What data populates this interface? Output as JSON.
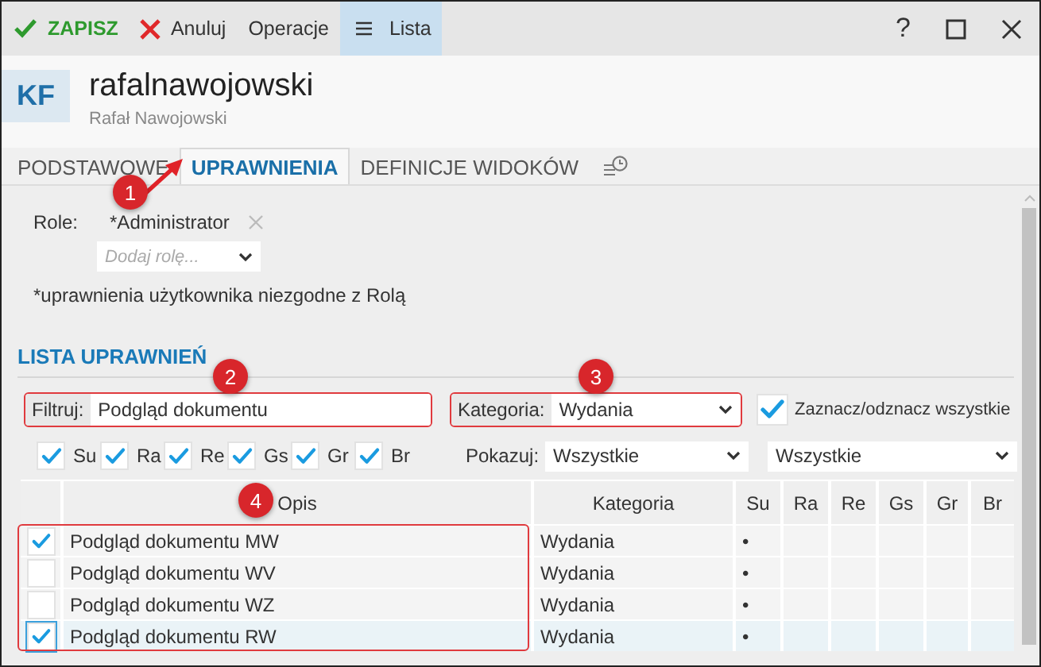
{
  "toolbar": {
    "buttons": [
      {
        "kind": "save",
        "label": "ZAPISZ",
        "selected": false
      },
      {
        "kind": "cancel",
        "label": "Anuluj",
        "selected": false
      },
      {
        "kind": "menu",
        "label": "Operacje",
        "selected": false
      },
      {
        "kind": "list",
        "label": "Lista",
        "selected": true
      }
    ],
    "window_buttons": [
      {
        "kind": "help",
        "label": "?"
      },
      {
        "kind": "maximize"
      },
      {
        "kind": "close"
      }
    ]
  },
  "header": {
    "avatar": "KF",
    "login": "rafalnawojowski",
    "full_name": "Rafał Nawojowski"
  },
  "tabs": [
    {
      "label": "PODSTAWOWE",
      "selected": false
    },
    {
      "label": "UPRAWNIENIA",
      "selected": true
    },
    {
      "label": "DEFINICJE WIDOKÓW",
      "selected": false
    }
  ],
  "roles": {
    "label": "Role:",
    "assigned": [
      {
        "name": "*Administrator"
      }
    ],
    "add_placeholder": "Dodaj rolę...",
    "note": "*uprawnienia użytkownika niezgodne z Rolą"
  },
  "permissions": {
    "title": "LISTA UPRAWNIEŃ",
    "filter": {
      "label": "Filtruj:",
      "value": "Podgląd dokumentu",
      "highlighted": true
    },
    "category": {
      "label": "Kategoria:",
      "value": "Wydania",
      "highlighted": true
    },
    "select_all": {
      "label": "Zaznacz/odznacz wszystkie",
      "checked": true
    },
    "flags": [
      {
        "label": "Su",
        "checked": true
      },
      {
        "label": "Ra",
        "checked": true
      },
      {
        "label": "Re",
        "checked": true
      },
      {
        "label": "Gs",
        "checked": true
      },
      {
        "label": "Gr",
        "checked": true
      },
      {
        "label": "Br",
        "checked": true
      }
    ],
    "show": {
      "label": "Pokazuj:",
      "value": "Wszystkie"
    },
    "show_2": {
      "value": "Wszystkie"
    },
    "table": {
      "columns": [
        "Opis",
        "Kategoria",
        "Su",
        "Ra",
        "Re",
        "Gs",
        "Gr",
        "Br"
      ],
      "rows_highlighted": true,
      "rows": [
        {
          "checked": true,
          "selected": false,
          "opis": "Podgląd dokumentu MW",
          "kategoria": "Wydania",
          "su": "•"
        },
        {
          "checked": false,
          "selected": false,
          "opis": "Podgląd dokumentu WV",
          "kategoria": "Wydania",
          "su": "•"
        },
        {
          "checked": false,
          "selected": false,
          "opis": "Podgląd dokumentu WZ",
          "kategoria": "Wydania",
          "su": "•"
        },
        {
          "checked": true,
          "selected": true,
          "opis": "Podgląd dokumentu RW",
          "kategoria": "Wydania",
          "su": "•"
        }
      ]
    }
  },
  "annotations": [
    {
      "label": "1",
      "arrow": true
    },
    {
      "label": "2",
      "arrow": false
    },
    {
      "label": "3",
      "arrow": false
    },
    {
      "label": "4",
      "arrow": false
    }
  ]
}
